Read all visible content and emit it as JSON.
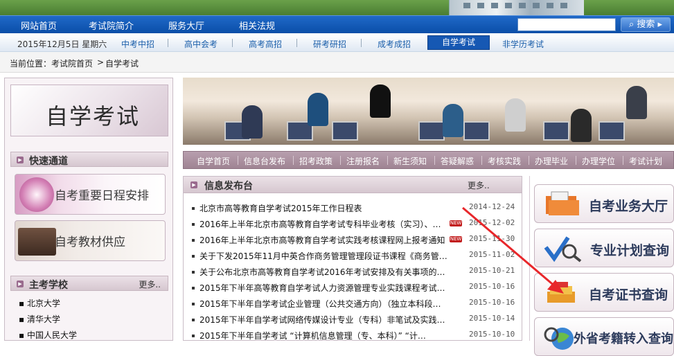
{
  "nav": {
    "items": [
      "网站首页",
      "考试院简介",
      "服务大厅",
      "相关法规"
    ],
    "search_button": "搜索"
  },
  "subnav": {
    "date": "2015年12月5日 星期六",
    "items": [
      "中考中招",
      "高中会考",
      "高考高招",
      "研考研招",
      "成考成招",
      "自学考试",
      "非学历考试"
    ],
    "active": "自学考试"
  },
  "breadcrumb": {
    "label": "当前位置：",
    "path": [
      "考试院首页",
      "自学考试"
    ]
  },
  "left": {
    "section_title": "自学考试",
    "quick_title": "快速通道",
    "banners": [
      "自考重要日程安排",
      "自考教材供应"
    ],
    "schools_title": "主考学校",
    "schools_more": "更多..",
    "schools": [
      "北京大学",
      "清华大学",
      "中国人民大学"
    ]
  },
  "menu": [
    "自学首页",
    "信息台发布",
    "招考政策",
    "注册报名",
    "新生须知",
    "答疑解惑",
    "考核实践",
    "办理毕业",
    "办理学位",
    "考试计划"
  ],
  "news": {
    "title": "信息发布台",
    "more": "更多..",
    "new_badge": "NEW",
    "items": [
      {
        "title": "北京市高等教育自学考试2015年工作日程表",
        "date": "2014-12-24",
        "new": false
      },
      {
        "title": "2016年上半年北京市高等教育自学考试专科毕业考核（实习）、…",
        "date": "2015-12-02",
        "new": true
      },
      {
        "title": "2016年上半年北京市高等教育自学考试实践考核课程网上报考通知",
        "date": "2015-11-30",
        "new": true
      },
      {
        "title": "关于下发2015年11月中英合作商务管理管理段证书课程《商务管…",
        "date": "2015-11-02",
        "new": false
      },
      {
        "title": "关于公布北京市高等教育自学考试2016年考试安排及有关事项的…",
        "date": "2015-10-21",
        "new": false
      },
      {
        "title": "2015年下半年高等教育自学考试人力资源管理专业实践课程考试…",
        "date": "2015-10-16",
        "new": false
      },
      {
        "title": "2015年下半年自学考试企业管理（公共交通方向）（独立本科段…",
        "date": "2015-10-16",
        "new": false
      },
      {
        "title": "2015年下半年自学考试网络传媒设计专业（专科）非笔试及实践…",
        "date": "2015-10-14",
        "new": false
      },
      {
        "title": "2015年下半年自学考试 “计算机信息管理（专、本科）” “计…",
        "date": "2015-10-10",
        "new": false
      }
    ]
  },
  "right": {
    "buttons": [
      "自考业务大厅",
      "专业计划查询",
      "自考证书查询",
      "外省考籍转入查询"
    ]
  },
  "colors": {
    "nav_blue": "#0a4ea8",
    "accent_mauve": "#9f8493",
    "arrow_red": "#e8272b"
  }
}
